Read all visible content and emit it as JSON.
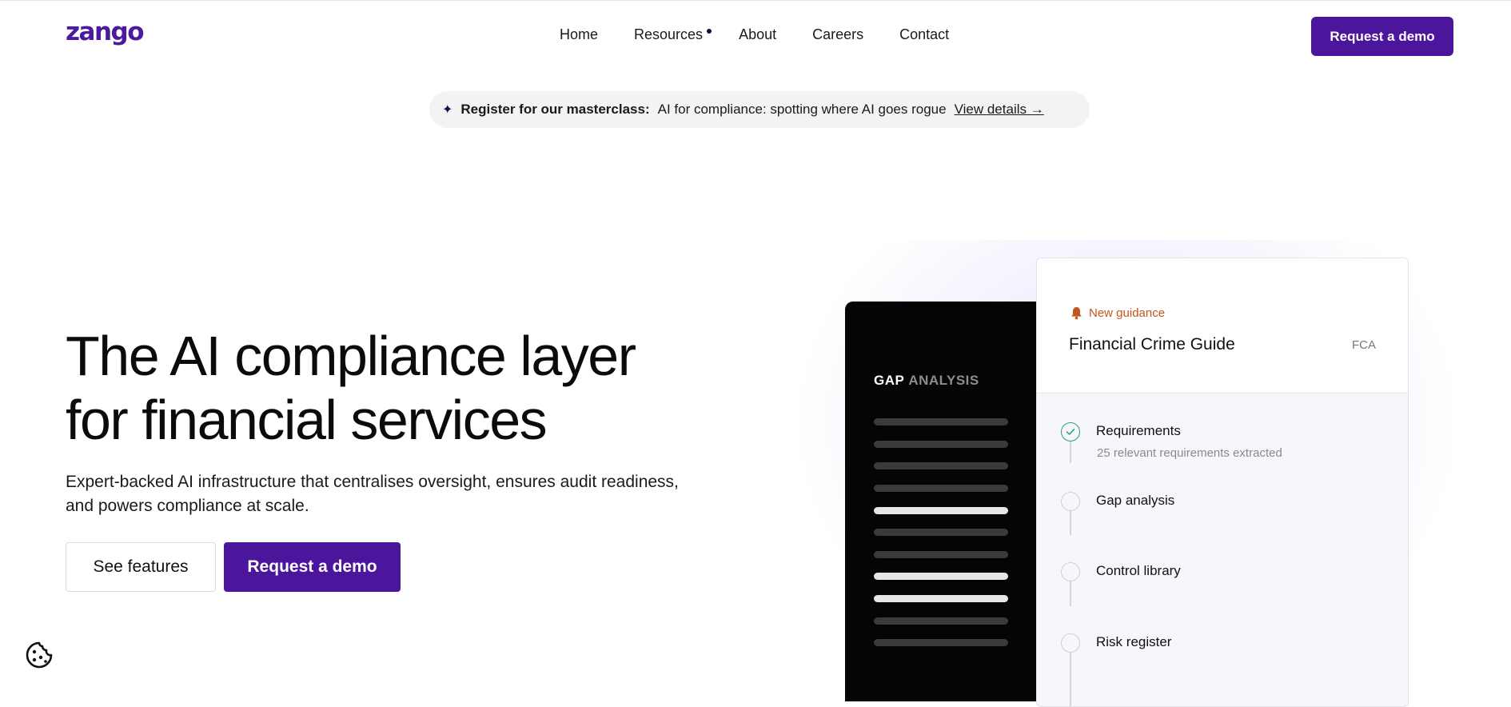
{
  "header": {
    "logo": "zango",
    "nav": [
      "Home",
      "Resources",
      "About",
      "Careers",
      "Contact"
    ],
    "cta": "Request a demo"
  },
  "announcement": {
    "lead": "Register for our masterclass:",
    "text": "AI for compliance: spotting where AI goes rogue",
    "link": "View details →"
  },
  "hero": {
    "title_line1": "The AI compliance layer",
    "title_line2": "for financial services",
    "subtitle_line1": "Expert-backed AI infrastructure that centralises oversight, ensures audit readiness,",
    "subtitle_line2": "and powers compliance at scale.",
    "secondary_cta": "See features",
    "primary_cta": "Request a demo"
  },
  "gap_panel": {
    "title_a": "GAP",
    "title_b": "ANALYSIS"
  },
  "guide_card": {
    "badge": "New guidance",
    "title": "Financial Crime Guide",
    "regulator": "FCA",
    "steps": [
      {
        "label": "Requirements",
        "desc": "25 relevant requirements extracted",
        "done": true
      },
      {
        "label": "Gap analysis",
        "desc": "",
        "done": false
      },
      {
        "label": "Control library",
        "desc": "",
        "done": false
      },
      {
        "label": "Risk register",
        "desc": "",
        "done": false
      }
    ]
  },
  "colors": {
    "brand": "#4b159c",
    "badge": "#c0561c",
    "check": "#2a9d7b"
  },
  "icons": [
    "sparkle-icon",
    "bell-icon",
    "check-icon",
    "cookie-icon"
  ]
}
